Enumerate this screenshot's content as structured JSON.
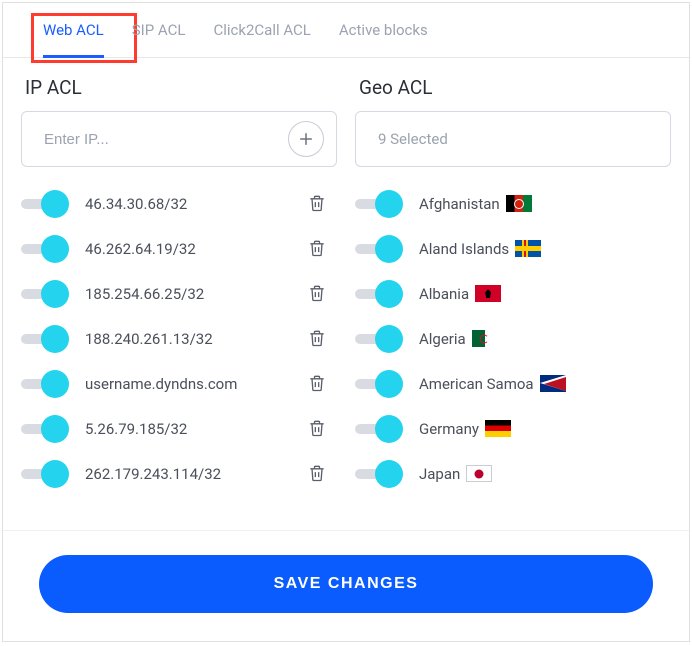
{
  "tabs": [
    {
      "label": "Web ACL",
      "active": true
    },
    {
      "label": "SIP ACL",
      "active": false
    },
    {
      "label": "Click2Call ACL",
      "active": false
    },
    {
      "label": "Active blocks",
      "active": false
    }
  ],
  "ip_acl": {
    "title": "IP ACL",
    "input_placeholder": "Enter IP...",
    "items": [
      {
        "value": "46.34.30.68/32"
      },
      {
        "value": "46.262.64.19/32"
      },
      {
        "value": "185.254.66.25/32"
      },
      {
        "value": "188.240.261.13/32"
      },
      {
        "value": "username.dyndns.com"
      },
      {
        "value": "5.26.79.185/32"
      },
      {
        "value": "262.179.243.114/32"
      }
    ]
  },
  "geo_acl": {
    "title": "Geo ACL",
    "selected_text": "9 Selected",
    "items": [
      {
        "name": "Afghanistan",
        "flag": "af"
      },
      {
        "name": "Aland Islands",
        "flag": "ax"
      },
      {
        "name": "Albania",
        "flag": "al"
      },
      {
        "name": "Algeria",
        "flag": "dz"
      },
      {
        "name": "American Samoa",
        "flag": "as"
      },
      {
        "name": "Germany",
        "flag": "de"
      },
      {
        "name": "Japan",
        "flag": "jp"
      }
    ]
  },
  "save_button": "SAVE CHANGES"
}
